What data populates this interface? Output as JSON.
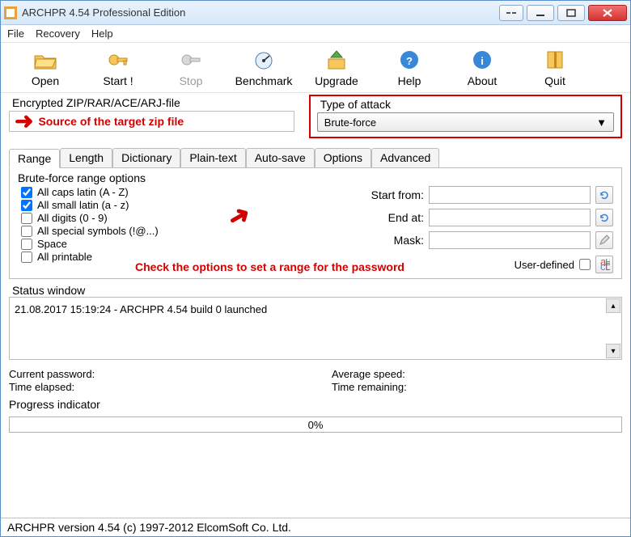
{
  "title": "ARCHPR 4.54 Professional Edition",
  "menu": {
    "file": "File",
    "recovery": "Recovery",
    "help": "Help"
  },
  "toolbar": {
    "open": "Open",
    "start": "Start !",
    "stop": "Stop",
    "benchmark": "Benchmark",
    "upgrade": "Upgrade",
    "help": "Help",
    "about": "About",
    "quit": "Quit"
  },
  "file_section": {
    "label": "Encrypted ZIP/RAR/ACE/ARJ-file",
    "annotation": "Source of the target zip file"
  },
  "attack": {
    "label": "Type of attack",
    "value": "Brute-force"
  },
  "tabs": [
    "Range",
    "Length",
    "Dictionary",
    "Plain-text",
    "Auto-save",
    "Options",
    "Advanced"
  ],
  "range": {
    "title": "Brute-force range options",
    "checks": {
      "caps": {
        "label": "All caps latin (A - Z)",
        "checked": true
      },
      "small": {
        "label": "All small latin (a - z)",
        "checked": true
      },
      "digits": {
        "label": "All digits (0 - 9)",
        "checked": false
      },
      "special": {
        "label": "All special symbols (!@...)",
        "checked": false
      },
      "space": {
        "label": "Space",
        "checked": false
      },
      "printable": {
        "label": "All printable",
        "checked": false
      }
    },
    "fields": {
      "start": "Start from:",
      "end": "End at:",
      "mask": "Mask:"
    },
    "userdef": "User-defined",
    "annotation": "Check the options to set a range for the password"
  },
  "status": {
    "label": "Status window",
    "line": "21.08.2017 15:19:24 - ARCHPR 4.54 build 0 launched"
  },
  "stats": {
    "current": "Current password:",
    "elapsed": "Time elapsed:",
    "avg": "Average speed:",
    "remaining": "Time remaining:",
    "progress_label": "Progress indicator",
    "progress_value": "0%"
  },
  "statusbar": "ARCHPR version 4.54 (c) 1997-2012 ElcomSoft Co. Ltd."
}
